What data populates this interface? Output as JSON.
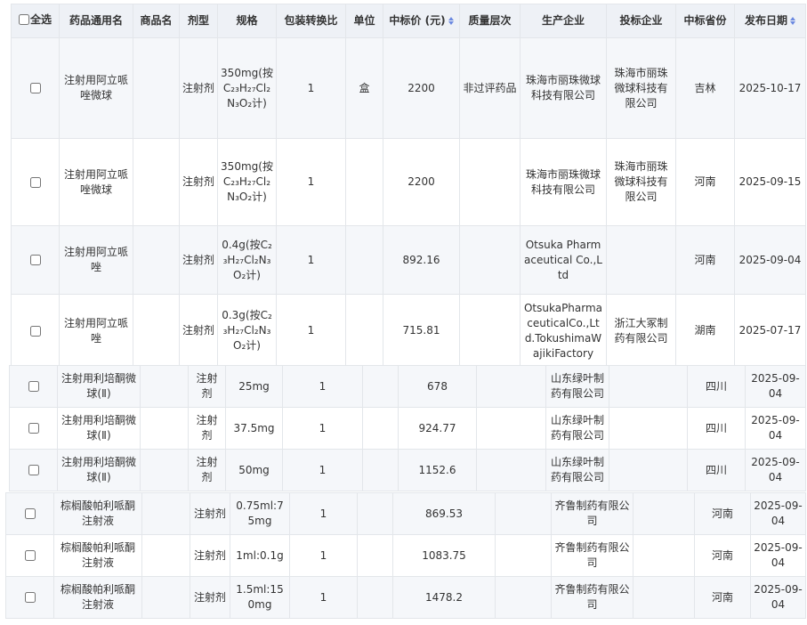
{
  "header": {
    "select_all": "全选",
    "generic_name": "药品通用名",
    "brand_name": "商品名",
    "dosage_form": "剂型",
    "spec": "规格",
    "pack_ratio": "包装转换比",
    "unit": "单位",
    "bid_price": "中标价 (元)",
    "quality_level": "质量层次",
    "manufacturer": "生产企业",
    "bidder": "投标企业",
    "province": "中标省份",
    "release_date": "发布日期"
  },
  "rows_a": [
    {
      "name": "注射用阿立哌唑微球",
      "form": "注射剂",
      "spec": "350mg(按C₂₃H₂₇Cl₂N₃O₂计)",
      "ratio": "1",
      "unit": "盒",
      "price": "2200",
      "quality": "非过评药品",
      "maker": "珠海市丽珠微球科技有限公司",
      "bidder": "珠海市丽珠微球科技有限公司",
      "province": "吉林",
      "date": "2025-10-17"
    },
    {
      "name": "注射用阿立哌唑微球",
      "form": "注射剂",
      "spec": "350mg(按C₂₃H₂₇Cl₂N₃O₂计)",
      "ratio": "1",
      "unit": "",
      "price": "2200",
      "quality": "",
      "maker": "珠海市丽珠微球科技有限公司",
      "bidder": "珠海市丽珠微球科技有限公司",
      "province": "河南",
      "date": "2025-09-15"
    },
    {
      "name": "注射用阿立哌唑",
      "form": "注射剂",
      "spec": "0.4g(按C₂₃H₂₇Cl₂N₃O₂计)",
      "ratio": "1",
      "unit": "",
      "price": "892.16",
      "quality": "",
      "maker": "Otsuka Pharmaceutical Co.,Ltd",
      "bidder": "",
      "province": "河南",
      "date": "2025-09-04"
    },
    {
      "name": "注射用阿立哌唑",
      "form": "注射剂",
      "spec": "0.3g(按C₂₃H₂₇Cl₂N₃O₂计)",
      "ratio": "1",
      "unit": "",
      "price": "715.81",
      "quality": "",
      "maker": "OtsukaPharmaceuticalCo.,Ltd.TokushimaWajikiFactory",
      "bidder": "浙江大冢制药有限公司",
      "province": "湖南",
      "date": "2025-07-17"
    }
  ],
  "rows_b": [
    {
      "name": "注射用利培酮微球(Ⅱ)",
      "form": "注射剂",
      "spec": "25mg",
      "ratio": "1",
      "unit": "",
      "price": "678",
      "quality": "",
      "maker": "山东绿叶制药有限公司",
      "bidder": "",
      "province": "四川",
      "date": "2025-09-04"
    },
    {
      "name": "注射用利培酮微球(Ⅱ)",
      "form": "注射剂",
      "spec": "37.5mg",
      "ratio": "1",
      "unit": "",
      "price": "924.77",
      "quality": "",
      "maker": "山东绿叶制药有限公司",
      "bidder": "",
      "province": "四川",
      "date": "2025-09-04"
    },
    {
      "name": "注射用利培酮微球(Ⅱ)",
      "form": "注射剂",
      "spec": "50mg",
      "ratio": "1",
      "unit": "",
      "price": "1152.6",
      "quality": "",
      "maker": "山东绿叶制药有限公司",
      "bidder": "",
      "province": "四川",
      "date": "2025-09-04"
    }
  ],
  "rows_c": [
    {
      "name": "棕榈酸帕利哌酮注射液",
      "form": "注射剂",
      "spec": "0.75ml:75mg",
      "ratio": "1",
      "unit": "",
      "price": "869.53",
      "quality": "",
      "maker": "齐鲁制药有限公司",
      "bidder": "",
      "province": "河南",
      "date": "2025-09-04"
    },
    {
      "name": "棕榈酸帕利哌酮注射液",
      "form": "注射剂",
      "spec": "1ml:0.1g",
      "ratio": "1",
      "unit": "",
      "price": "1083.75",
      "quality": "",
      "maker": "齐鲁制药有限公司",
      "bidder": "",
      "province": "河南",
      "date": "2025-09-04"
    },
    {
      "name": "棕榈酸帕利哌酮注射液",
      "form": "注射剂",
      "spec": "1.5ml:150mg",
      "ratio": "1",
      "unit": "",
      "price": "1478.2",
      "quality": "",
      "maker": "齐鲁制药有限公司",
      "bidder": "",
      "province": "河南",
      "date": "2025-09-04"
    }
  ]
}
